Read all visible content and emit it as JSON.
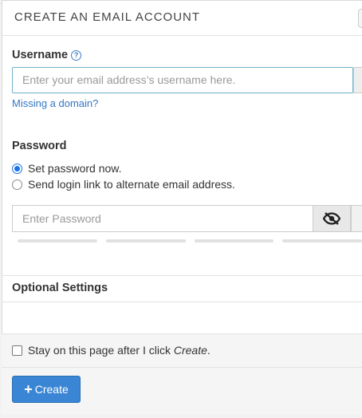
{
  "panel": {
    "title": "CREATE AN EMAIL ACCOUNT"
  },
  "username": {
    "label": "Username",
    "help_icon": "?",
    "placeholder": "Enter your email address’s username here.",
    "missing_domain_link": "Missing a domain?"
  },
  "password": {
    "label": "Password",
    "options": [
      {
        "label": "Set password now.",
        "selected": true
      },
      {
        "label": "Send login link to alternate email address.",
        "selected": false
      }
    ],
    "placeholder": "Enter Password",
    "visibility_icon": "eye-slash-icon"
  },
  "optional_settings": {
    "title": "Optional Settings"
  },
  "footer": {
    "stay_label_prefix": "Stay on this page after I click ",
    "stay_label_emph": "Create",
    "stay_label_suffix": ".",
    "stay_checked": false,
    "create_label": "Create",
    "create_icon": "+"
  },
  "colors": {
    "accent": "#3a86d4",
    "link": "#3278c4",
    "radio": "#1a73e8"
  }
}
